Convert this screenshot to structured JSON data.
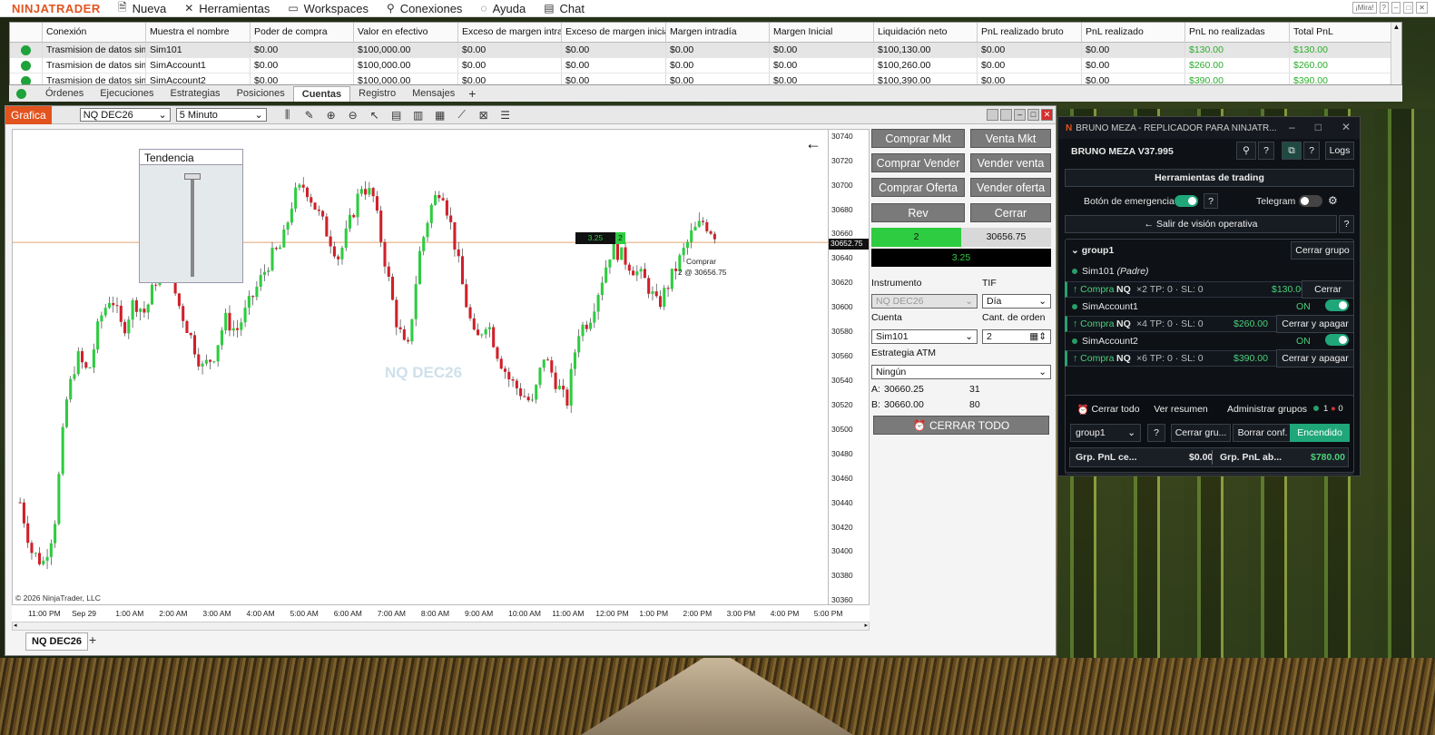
{
  "menubar": {
    "logo": "NINJATRADER",
    "items": [
      {
        "label": "Nueva",
        "icon": "new-document-icon"
      },
      {
        "label": "Herramientas",
        "icon": "tools-icon"
      },
      {
        "label": "Workspaces",
        "icon": "workspace-icon"
      },
      {
        "label": "Conexiones",
        "icon": "plug-icon"
      },
      {
        "label": "Ayuda",
        "icon": "help-circle-icon"
      },
      {
        "label": "Chat",
        "icon": "chat-icon"
      }
    ],
    "mira": "¡Mira!"
  },
  "accounts": {
    "columns": [
      "Conexión",
      "Muestra el nombre",
      "Poder de compra",
      "Valor en efectivo",
      "Exceso de margen intrac",
      "Exceso de margen inicial",
      "Margen intradía",
      "Margen Inicial",
      "Liquidación neto",
      "PnL realizado bruto",
      "PnL realizado",
      "PnL no realizadas",
      "Total PnL"
    ],
    "rows": [
      [
        "Trasmision de datos sim",
        "Sim101",
        "$0.00",
        "$100,000.00",
        "$0.00",
        "$0.00",
        "$0.00",
        "$0.00",
        "$100,130.00",
        "$0.00",
        "$0.00",
        "$130.00",
        "$130.00"
      ],
      [
        "Trasmision de datos sim",
        "SimAccount1",
        "$0.00",
        "$100,000.00",
        "$0.00",
        "$0.00",
        "$0.00",
        "$0.00",
        "$100,260.00",
        "$0.00",
        "$0.00",
        "$260.00",
        "$260.00"
      ],
      [
        "Trasmision de datos sim",
        "SimAccount2",
        "$0.00",
        "$100,000.00",
        "$0.00",
        "$0.00",
        "$0.00",
        "$0.00",
        "$100,390.00",
        "$0.00",
        "$0.00",
        "$390.00",
        "$390.00"
      ]
    ]
  },
  "tabs": [
    "Órdenes",
    "Ejecuciones",
    "Estrategias",
    "Posiciones",
    "Cuentas",
    "Registro",
    "Mensajes"
  ],
  "tabs_active": "Cuentas",
  "chart": {
    "title": "Grafica",
    "instrument": "NQ DEC26",
    "interval": "5 Minuto",
    "tendency": "Tendencia",
    "watermark": "NQ DEC26",
    "copyright": "© 2026 NinjaTrader, LLC",
    "bottom_tab": "NQ DEC26",
    "price_label": "30652.75",
    "order_marker": "3.25",
    "order_qty": "2",
    "order_note_1": "Comprar",
    "order_note_2": "2 @ 30656.75"
  },
  "chart_data": {
    "type": "candlestick",
    "title": "",
    "ylim": [
      30355,
      30745
    ],
    "y_ticks": [
      30740,
      30720,
      30700,
      30680,
      30660,
      30640,
      30620,
      30600,
      30580,
      30560,
      30540,
      30520,
      30500,
      30480,
      30460,
      30440,
      30420,
      30400,
      30380,
      30360
    ],
    "x_ticks": [
      "11:00 PM",
      "Sep 29",
      "1:00 AM",
      "2:00 AM",
      "3:00 AM",
      "4:00 AM",
      "5:00 AM",
      "6:00 AM",
      "7:00 AM",
      "8:00 AM",
      "9:00 AM",
      "10:00 AM",
      "11:00 AM",
      "12:00 PM",
      "1:00 PM",
      "2:00 PM",
      "3:00 PM",
      "4:00 PM",
      "5:00 PM"
    ],
    "current_price": 30652.75,
    "close_path": [
      30440,
      30400,
      30390,
      30420,
      30520,
      30560,
      30545,
      30590,
      30610,
      30580,
      30605,
      30595,
      30625,
      30630,
      30600,
      30575,
      30550,
      30560,
      30590,
      30580,
      30600,
      30620,
      30640,
      30650,
      30690,
      30700,
      30680,
      30660,
      30640,
      30670,
      30700,
      30690,
      30640,
      30590,
      30560,
      30640,
      30680,
      30700,
      30660,
      30610,
      30570,
      30590,
      30560,
      30540,
      30530,
      30520,
      30560,
      30540,
      30520,
      30580,
      30590,
      30620,
      30650,
      30640,
      30630,
      30620,
      30600,
      30620,
      30640,
      30660,
      30670,
      30660
    ]
  },
  "order_panel": {
    "buy_mkt": "Comprar Mkt",
    "sell_mkt": "Venta Mkt",
    "buy_sell": "Comprar Vender",
    "sell_sell": "Vender venta",
    "buy_offer": "Comprar Oferta",
    "sell_offer": "Vender oferta",
    "rev": "Rev",
    "close": "Cerrar",
    "position_qty": "2",
    "position_price": "30656.75",
    "pnl": "3.25",
    "instrument_label": "Instrumento",
    "instrument": "NQ DEC26",
    "tif_label": "TIF",
    "tif": "Día",
    "account_label": "Cuenta",
    "account": "Sim101",
    "qty_label": "Cant. de orden",
    "qty": "2",
    "atm_label": "Estrategia ATM",
    "atm": "Ningún",
    "ask_label": "A:",
    "ask": "30660.25",
    "ask_size": "31",
    "bid_label": "B:",
    "bid": "30660.00",
    "bid_size": "80",
    "close_all": "CERRAR TODO"
  },
  "replicator": {
    "window_title": "BRUNO MEZA - REPLICADOR PARA NINJATR...",
    "version": "BRUNO MEZA V37.995",
    "logs": "Logs",
    "help": "?",
    "tools": "Herramientas de trading",
    "emergency": "Botón de emergencia",
    "telegram": "Telegram",
    "exit_ops": "Salir de visión operativa",
    "group_name": "group1",
    "close_group": "Cerrar grupo",
    "sim101": "Sim101",
    "sim101_role": "(Padre)",
    "pos1": {
      "side": "↑ Compra",
      "sym": "NQ",
      "detail": "×2 TP: 0 · SL: 0",
      "pnl": "$130.00",
      "action": "Cerrar"
    },
    "acc1": "SimAccount1",
    "acc1_state": "ON",
    "pos2": {
      "side": "↑ Compra",
      "sym": "NQ",
      "detail": "×4 TP: 0 · SL: 0",
      "pnl": "$260.00",
      "action": "Cerrar y apagar"
    },
    "acc2": "SimAccount2",
    "acc2_state": "ON",
    "pos3": {
      "side": "↑ Compra",
      "sym": "NQ",
      "detail": "×6 TP: 0 · SL: 0",
      "pnl": "$390.00",
      "action": "Cerrar y apagar"
    },
    "close_all": "Cerrar todo",
    "summary": "Ver resumen",
    "manage": "Administrar grupos",
    "count_on": "1",
    "count_off": "0",
    "group_select": "group1",
    "close_gr_short": "Cerrar gru...",
    "delete_conf": "Borrar conf.",
    "on": "Encendido",
    "grp_closed_label": "Grp. PnL ce...",
    "grp_closed": "$0.00",
    "grp_open_label": "Grp. PnL ab...",
    "grp_open": "$780.00"
  },
  "colors": {
    "brand": "#e2531e",
    "up": "#2ecc40",
    "down": "#d0202a",
    "accent": "#1fa77a"
  }
}
